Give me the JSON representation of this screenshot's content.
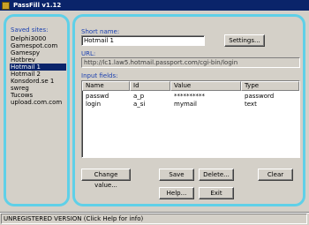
{
  "window": {
    "title": "PassFill v1.12",
    "icon": "passfill-app-icon"
  },
  "sidebar": {
    "label": "Saved sites:",
    "items": [
      {
        "label": "Delphi3000",
        "selected": false
      },
      {
        "label": "Gamespot.com",
        "selected": false
      },
      {
        "label": "Gamespy",
        "selected": false
      },
      {
        "label": "Hotbrev",
        "selected": false
      },
      {
        "label": "Hotmail 1",
        "selected": true
      },
      {
        "label": "Hotmail 2",
        "selected": false
      },
      {
        "label": "Konsdord.se 1",
        "selected": false
      },
      {
        "label": "swreg",
        "selected": false
      },
      {
        "label": "Tucows",
        "selected": false
      },
      {
        "label": "upload.com.com",
        "selected": false
      }
    ]
  },
  "form": {
    "short_name_label": "Short name:",
    "short_name_value": "Hotmail 1",
    "settings_label": "Settings...",
    "url_label": "URL:",
    "url_value": "http://lc1.law5.hotmail.passport.com/cgi-bin/login",
    "input_fields_label": "Input fields:",
    "columns": [
      "Name",
      "Id",
      "Value",
      "Type"
    ],
    "rows": [
      {
        "name": "passwd",
        "id": "a_p",
        "value": "**********",
        "type": "password"
      },
      {
        "name": "login",
        "id": "a_si",
        "value": "mymail",
        "type": "text"
      }
    ]
  },
  "buttons": {
    "change_value": "Change value...",
    "save": "Save",
    "delete": "Delete...",
    "clear": "Clear",
    "help": "Help...",
    "exit": "Exit"
  },
  "status": {
    "text": "UNREGISTERED VERSION (Click Help for info)"
  },
  "colors": {
    "accent": "#5fd0e8",
    "label_blue": "#1a3fb0",
    "selection": "#0a246a"
  }
}
